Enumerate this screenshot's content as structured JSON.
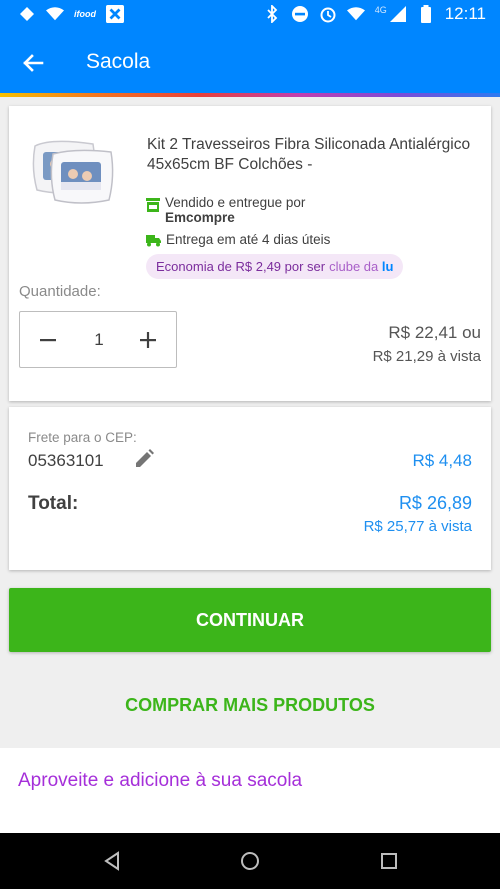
{
  "status_bar": {
    "time": "12:11",
    "network": "4G",
    "app_badge": "ifood",
    "icons": [
      "diamond-icon",
      "wifi-icon",
      "ifood-icon",
      "x-app-icon",
      "bluetooth-icon",
      "do-not-disturb-icon",
      "alarm-icon",
      "wifi-icon",
      "signal-icon",
      "battery-icon"
    ]
  },
  "header": {
    "title": "Sacola",
    "back_icon": "arrow-left-icon",
    "color": "#0086ff"
  },
  "product": {
    "title": "Kit 2 Travesseiros Fibra Siliconada Antialérgico 45x65cm BF Colchões -",
    "seller_label": "Vendido e entregue por",
    "seller_name": "Emcompre",
    "delivery": "Entrega em até 4 dias úteis",
    "economia_text": "Economia de R$ 2,49 por ser",
    "clube_text": "clube da",
    "clube_lu": "lu",
    "quantity_label": "Quantidade:",
    "quantity": "1",
    "price": "R$ 22,41 ou",
    "price_vista": "R$ 21,29 à vista"
  },
  "frete": {
    "label": "Frete para o CEP:",
    "cep": "05363101",
    "price": "R$ 4,48",
    "total_label": "Total:",
    "total_price": "R$ 26,89",
    "total_vista": "R$ 25,77 à vista"
  },
  "actions": {
    "continuar": "CONTINUAR",
    "comprar_mais": "COMPRAR MAIS PRODUTOS"
  },
  "aproveite": {
    "text": "Aproveite e adicione à sua sacola"
  },
  "colors": {
    "primary_blue": "#0086ff",
    "green": "#3cb51a",
    "price_blue": "#1e8ff0",
    "purple": "#a52fd9"
  }
}
